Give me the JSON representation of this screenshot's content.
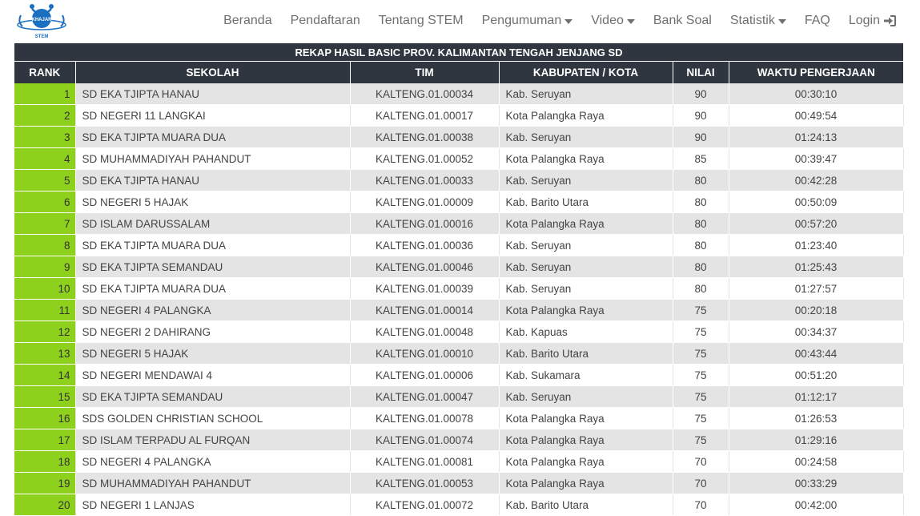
{
  "nav": {
    "logo_text_top": "KHAJAR",
    "logo_text_bottom": "STEM",
    "items": [
      {
        "label": "Beranda",
        "dropdown": false
      },
      {
        "label": "Pendaftaran",
        "dropdown": false
      },
      {
        "label": "Tentang STEM",
        "dropdown": false
      },
      {
        "label": "Pengumuman",
        "dropdown": true
      },
      {
        "label": "Video",
        "dropdown": true
      },
      {
        "label": "Bank Soal",
        "dropdown": false
      },
      {
        "label": "Statistik",
        "dropdown": true
      },
      {
        "label": "FAQ",
        "dropdown": false
      },
      {
        "label": "Login",
        "dropdown": false
      }
    ]
  },
  "table": {
    "caption": "REKAP HASIL BASIC PROV. KALIMANTAN TENGAH JENJANG SD",
    "headers": [
      "RANK",
      "SEKOLAH",
      "TIM",
      "KABUPATEN / KOTA",
      "NILAI",
      "WAKTU PENGERJAAN"
    ],
    "rows": [
      [
        "1",
        "SD EKA TJIPTA HANAU",
        "KALTENG.01.00034",
        "Kab. Seruyan",
        "90",
        "00:30:10"
      ],
      [
        "2",
        "SD NEGERI 11 LANGKAI",
        "KALTENG.01.00017",
        "Kota Palangka Raya",
        "90",
        "00:49:54"
      ],
      [
        "3",
        "SD EKA TJIPTA MUARA DUA",
        "KALTENG.01.00038",
        "Kab. Seruyan",
        "90",
        "01:24:13"
      ],
      [
        "4",
        "SD MUHAMMADIYAH PAHANDUT",
        "KALTENG.01.00052",
        "Kota Palangka Raya",
        "85",
        "00:39:47"
      ],
      [
        "5",
        "SD EKA TJIPTA HANAU",
        "KALTENG.01.00033",
        "Kab. Seruyan",
        "80",
        "00:42:28"
      ],
      [
        "6",
        "SD NEGERI 5 HAJAK",
        "KALTENG.01.00009",
        "Kab. Barito Utara",
        "80",
        "00:50:09"
      ],
      [
        "7",
        "SD ISLAM DARUSSALAM",
        "KALTENG.01.00016",
        "Kota Palangka Raya",
        "80",
        "00:57:20"
      ],
      [
        "8",
        "SD EKA TJIPTA MUARA DUA",
        "KALTENG.01.00036",
        "Kab. Seruyan",
        "80",
        "01:23:40"
      ],
      [
        "9",
        "SD EKA TJIPTA SEMANDAU",
        "KALTENG.01.00046",
        "Kab. Seruyan",
        "80",
        "01:25:43"
      ],
      [
        "10",
        "SD EKA TJIPTA MUARA DUA",
        "KALTENG.01.00039",
        "Kab. Seruyan",
        "80",
        "01:27:57"
      ],
      [
        "11",
        "SD NEGERI 4 PALANGKA",
        "KALTENG.01.00014",
        "Kota Palangka Raya",
        "75",
        "00:20:18"
      ],
      [
        "12",
        "SD NEGERI 2 DAHIRANG",
        "KALTENG.01.00048",
        "Kab. Kapuas",
        "75",
        "00:34:37"
      ],
      [
        "13",
        "SD NEGERI 5 HAJAK",
        "KALTENG.01.00010",
        "Kab. Barito Utara",
        "75",
        "00:43:44"
      ],
      [
        "14",
        "SD NEGERI MENDAWAI 4",
        "KALTENG.01.00006",
        "Kab. Sukamara",
        "75",
        "00:51:20"
      ],
      [
        "15",
        "SD EKA TJIPTA SEMANDAU",
        "KALTENG.01.00047",
        "Kab. Seruyan",
        "75",
        "01:12:17"
      ],
      [
        "16",
        "SDS GOLDEN CHRISTIAN SCHOOL",
        "KALTENG.01.00078",
        "Kota Palangka Raya",
        "75",
        "01:26:53"
      ],
      [
        "17",
        "SD ISLAM TERPADU AL FURQAN",
        "KALTENG.01.00074",
        "Kota Palangka Raya",
        "75",
        "01:29:16"
      ],
      [
        "18",
        "SD NEGERI 4 PALANGKA",
        "KALTENG.01.00081",
        "Kota Palangka Raya",
        "70",
        "00:24:58"
      ],
      [
        "19",
        "SD MUHAMMADIYAH PAHANDUT",
        "KALTENG.01.00053",
        "Kota Palangka Raya",
        "70",
        "00:33:29"
      ],
      [
        "20",
        "SD NEGERI 1 LANJAS",
        "KALTENG.01.00072",
        "Kab. Barito Utara",
        "70",
        "00:42:00"
      ]
    ]
  },
  "colors": {
    "header_bg": "#2f3640",
    "rank_bg": "#8ed11c",
    "row_stripe": "#e4e4e4",
    "logo_blue": "#1a6fc0"
  }
}
